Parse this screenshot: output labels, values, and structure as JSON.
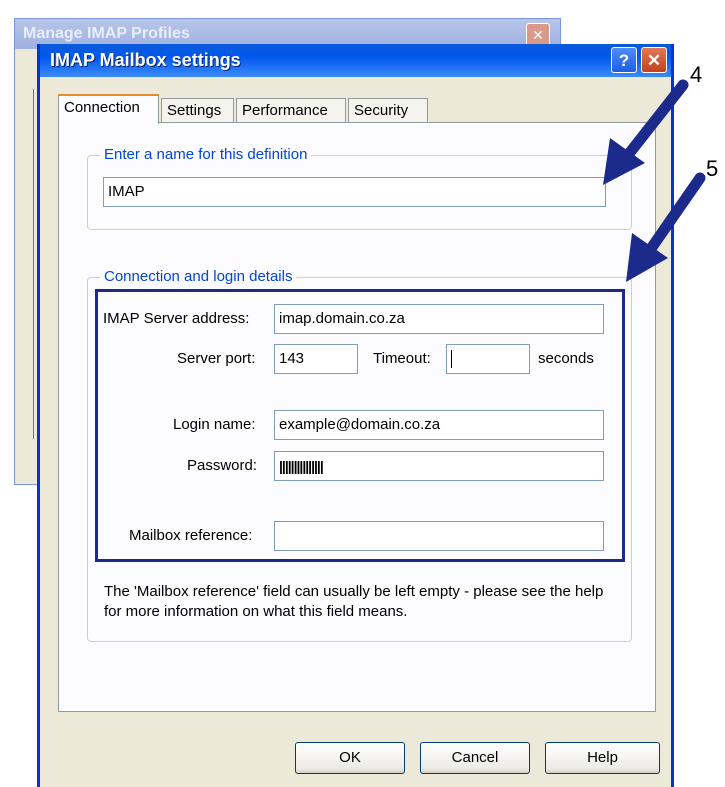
{
  "background_window": {
    "title": "Manage IMAP Profiles",
    "close_glyph": "✕"
  },
  "dialog": {
    "title": "IMAP Mailbox settings",
    "help_glyph": "?",
    "close_glyph": "✕"
  },
  "tabs": [
    {
      "label": "Connection",
      "active": true
    },
    {
      "label": "Settings",
      "active": false
    },
    {
      "label": "Performance",
      "active": false
    },
    {
      "label": "Security",
      "active": false
    }
  ],
  "definition_group": {
    "legend": "Enter a name for this definition",
    "name_value": "IMAP"
  },
  "login_group": {
    "legend": "Connection and login details",
    "server_label": "IMAP Server address:",
    "server_value": "imap.domain.co.za",
    "port_label": "Server port:",
    "port_value": "143",
    "timeout_label": "Timeout:",
    "timeout_value": "",
    "timeout_unit": "seconds",
    "login_label": "Login name:",
    "login_value": "example@domain.co.za",
    "password_label": "Password:",
    "password_value": "|||||||||||||||",
    "mailbox_label": "Mailbox reference:",
    "mailbox_value": "",
    "note": "The 'Mailbox reference' field can usually be left empty - please see the help for more information on what this field means."
  },
  "buttons": {
    "ok": "OK",
    "cancel": "Cancel",
    "help": "Help"
  },
  "callouts": {
    "first": "4",
    "second": "5"
  },
  "colors": {
    "title_blue": "#0058ee",
    "highlight_border": "#1c2a8c",
    "legend_blue": "#0046d5"
  }
}
